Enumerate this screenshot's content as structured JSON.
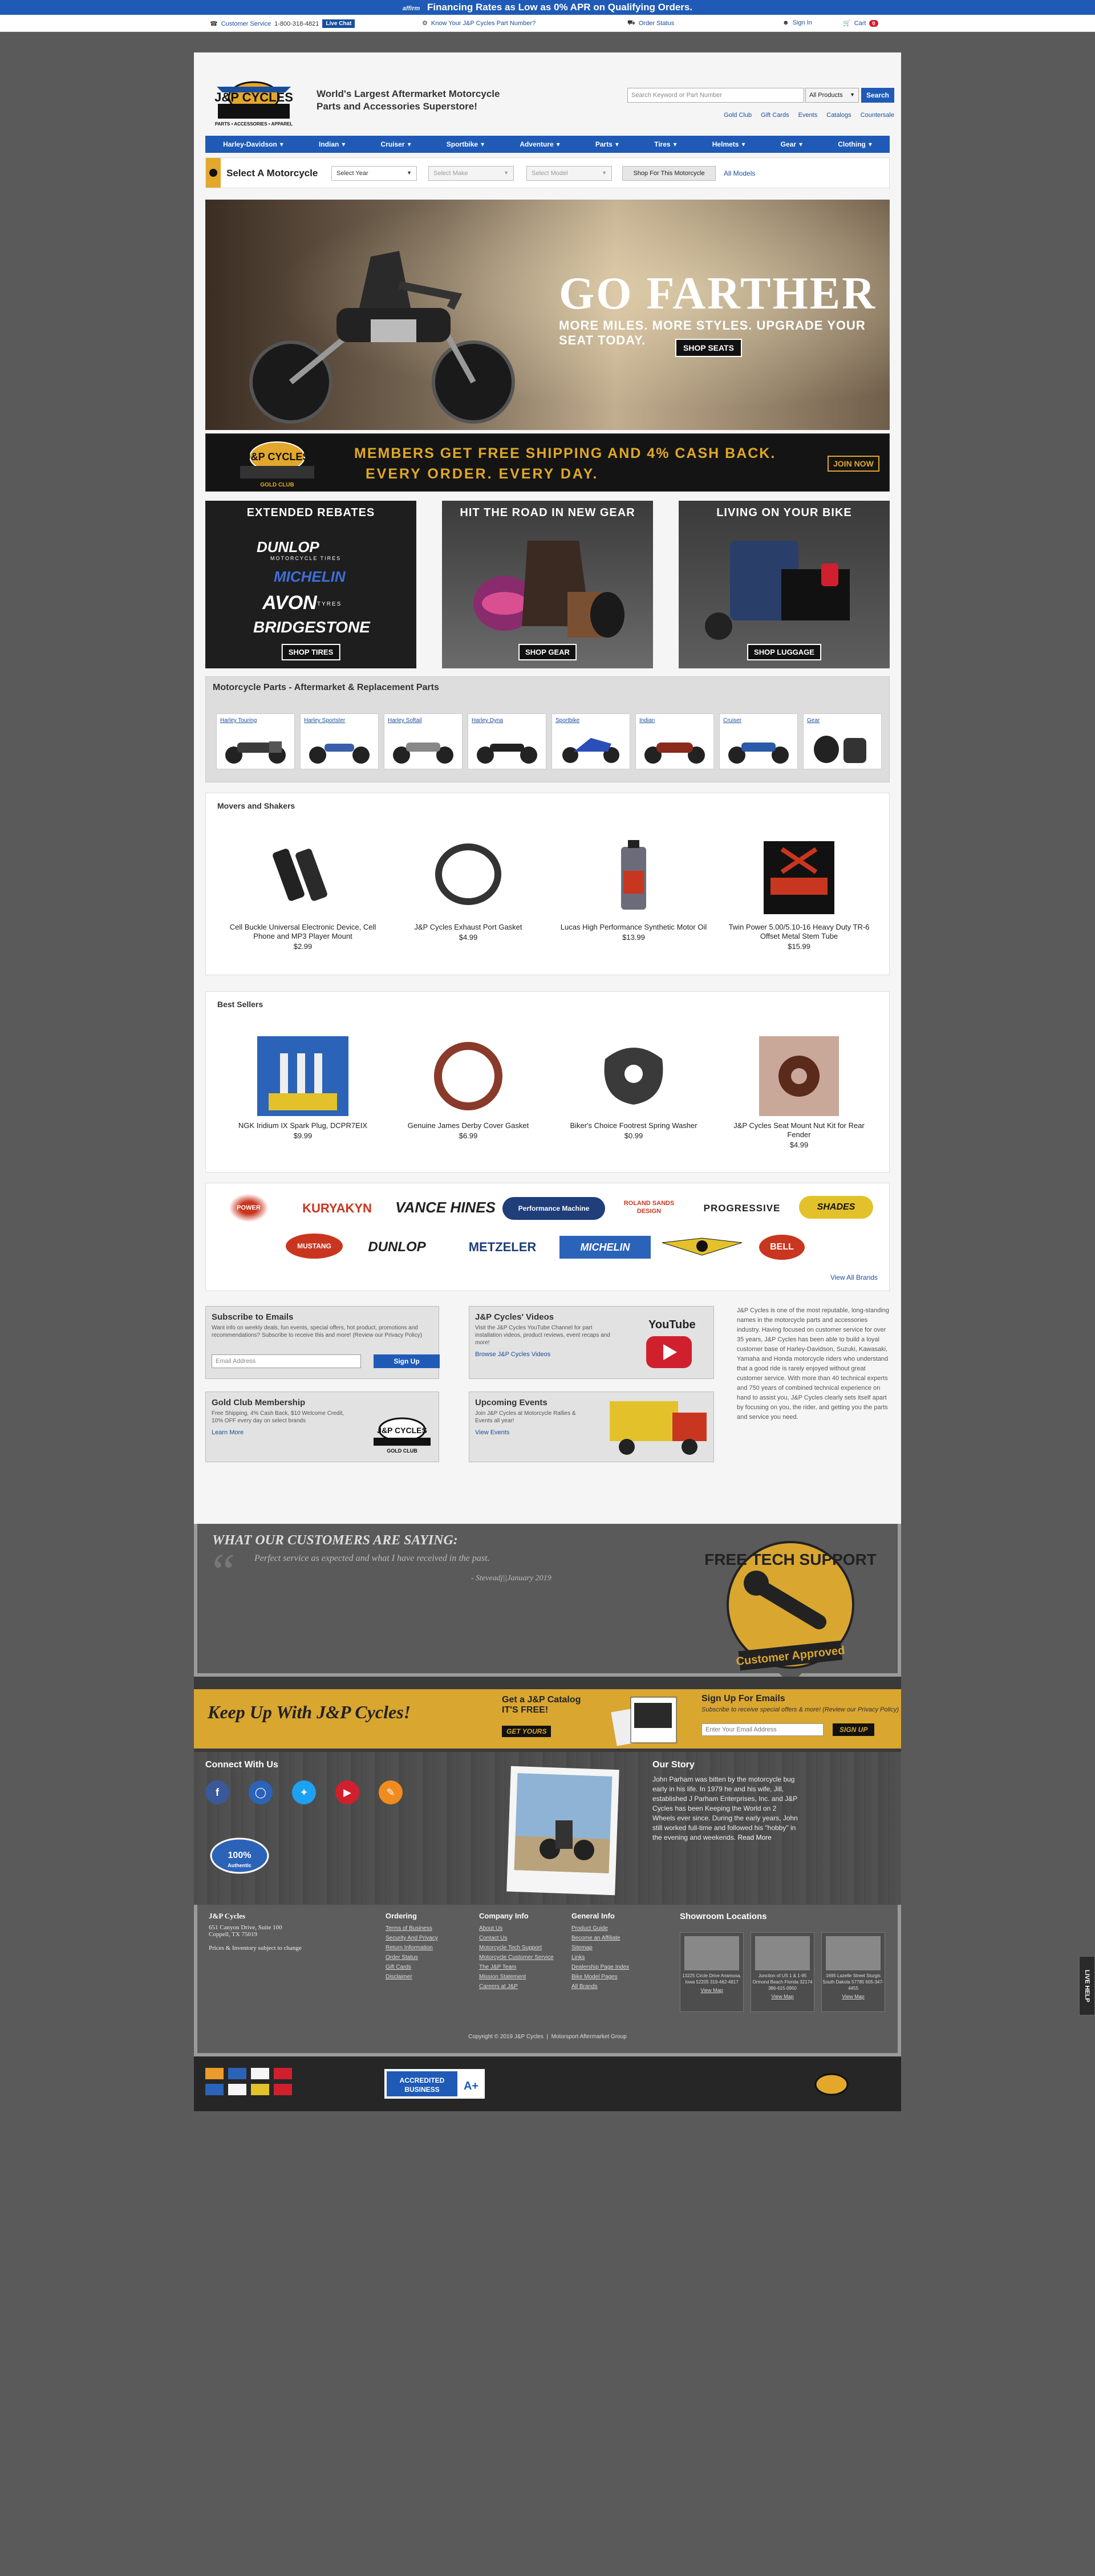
{
  "promo": {
    "brand": "affirm",
    "text": "Financing Rates as Low as 0% APR on Qualifying Orders."
  },
  "util": {
    "customer_service": "Customer Service",
    "phone": "1-800-318-4821",
    "live_chat": "Live Chat",
    "know_part": "Know Your J&P Cycles Part Number?",
    "order_status": "Order Status",
    "sign_in": "Sign In",
    "cart": "Cart",
    "cart_count": "0"
  },
  "header": {
    "logo_text": "J&P CYCLES",
    "logo_sub": "PARTS • ACCESSORIES • APPAREL",
    "tagline": "World's Largest Aftermarket Motorcycle Parts and Accessories Superstore!",
    "search_placeholder": "Search Keyword or Part Number",
    "search_scope": "All Products",
    "search_btn": "Search",
    "links": [
      "Gold Club",
      "Gift Cards",
      "Events",
      "Catalogs",
      "Countersale"
    ]
  },
  "nav": [
    "Harley-Davidson",
    "Indian",
    "Cruiser",
    "Sportbike",
    "Adventure",
    "Parts",
    "Tires",
    "Helmets",
    "Gear",
    "Clothing"
  ],
  "select_moto": {
    "title": "Select A Motorcycle",
    "year": "Select Year",
    "make": "Select Make",
    "model": "Select Model",
    "shop_btn": "Shop For This Motorcycle",
    "all_models": "All Models"
  },
  "hero": {
    "title": "GO FARTHER",
    "sub": "MORE MILES. MORE STYLES. UPGRADE YOUR SEAT TODAY.",
    "btn": "SHOP SEATS"
  },
  "gold": {
    "l1": "MEMBERS GET FREE SHIPPING AND 4% CASH BACK.",
    "l2": "EVERY ORDER. EVERY DAY.",
    "join": "JOIN NOW",
    "logo_sub": "GOLD CLUB"
  },
  "promos": [
    {
      "title": "EXTENDED REBATES",
      "btn": "SHOP TIRES",
      "brands": [
        "DUNLOP",
        "MICHELIN",
        "AVON",
        "BRIDGESTONE"
      ],
      "dunlop_sub": "MOTORCYCLE TIRES",
      "avon_sub": "TYRES"
    },
    {
      "title": "HIT THE ROAD IN NEW GEAR",
      "btn": "SHOP GEAR"
    },
    {
      "title": "LIVING ON YOUR BIKE",
      "btn": "SHOP LUGGAGE"
    }
  ],
  "parts": {
    "title": "Motorcycle Parts - Aftermarket & Replacement Parts",
    "items": [
      "Harley Touring",
      "Harley Sportster",
      "Harley Softail",
      "Harley Dyna",
      "Sportbike",
      "Indian",
      "Cruiser",
      "Gear"
    ]
  },
  "movers": {
    "title": "Movers and Shakers",
    "items": [
      {
        "name": "Cell Buckle Universal Electronic Device, Cell Phone and MP3 Player Mount",
        "price": "$2.99"
      },
      {
        "name": "J&P Cycles Exhaust Port Gasket",
        "price": "$4.99"
      },
      {
        "name": "Lucas High Performance Synthetic Motor Oil",
        "price": "$13.99"
      },
      {
        "name": "Twin Power 5.00/5.10-16 Heavy Duty TR-6 Offset Metal Stem Tube",
        "price": "$15.99"
      }
    ]
  },
  "best": {
    "title": "Best Sellers",
    "items": [
      {
        "name": "NGK Iridium IX Spark Plug, DCPR7EIX",
        "price": "$9.99"
      },
      {
        "name": "Genuine James Derby Cover Gasket",
        "price": "$6.99"
      },
      {
        "name": "Biker's Choice Footrest Spring Washer",
        "price": "$0.99"
      },
      {
        "name": "J&P Cycles Seat Mount Nut Kit for Rear Fender",
        "price": "$4.99"
      }
    ]
  },
  "brands": {
    "row1": [
      "POWER",
      "KURYAKYN",
      "VANCE HINES",
      "Performance Machine",
      "ROLAND SANDS DESIGN",
      "PROGRESSIVE",
      "SHADES"
    ],
    "row2": [
      "MUSTANG",
      "DUNLOP",
      "METZELER",
      "MICHELIN",
      "",
      "BELL"
    ],
    "view_all": "View All Brands"
  },
  "subscribe": {
    "title": "Subscribe to Emails",
    "desc": "Want info on weekly deals, fun events, special offers, hot product, promotions and recommendations? Subscribe to receive this and more! (Review our Privacy Policy)",
    "placeholder": "Email Address",
    "btn": "Sign Up"
  },
  "videos": {
    "title": "J&P Cycles' Videos",
    "desc": "Visit the J&P Cycles YouTube Channel for part installation videos, product reviews, event recaps and more!",
    "link": "Browse J&P Cycles Videos",
    "yt": "YouTube"
  },
  "goldclub": {
    "title": "Gold Club Membership",
    "desc": "Free Shipping, 4% Cash Back, $10 Welcome Credit, 10% OFF every day on select brands",
    "link": "Learn More"
  },
  "events": {
    "title": "Upcoming Events",
    "desc": "Join J&P Cycles at Motorcycle Rallies & Events all year!",
    "link": "View Events"
  },
  "about": "J&P Cycles is one of the most reputable, long-standing names in the motorcycle parts and accessories industry. Having focused on customer service for over 35 years, J&P Cycles has been able to build a loyal customer base of Harley-Davidson, Suzuki, Kawasaki, Yamaha and Honda motorcycle riders who understand that a good ride is rarely enjoyed without great customer service. With more than 40 technical experts and 750 years of combined technical experience on hand to assist you, J&P Cycles clearly sets itself apart by focusing on you, the rider, and getting you the parts and service you need.",
  "testimonials": {
    "heading": "WHAT OUR CUSTOMERS ARE SAYING:",
    "quote": "Perfect service as expected and what I have received in the past.",
    "author": "- Steveadj||January 2019"
  },
  "tech": {
    "l1": "FREE TECH SUPPORT",
    "l2": "Customer Approved"
  },
  "keepup": {
    "heading": "Keep Up With J&P Cycles!",
    "cat": "Get a J&P Catalog",
    "free": "IT'S FREE!",
    "getyours": "GET YOURS",
    "signup_title": "Sign Up For Emails",
    "signup_desc": "Subscribe to receive special offers & more! (Review our Privacy Policy)",
    "email_ph": "Enter Your Email Address",
    "signup_btn": "SIGN UP"
  },
  "connect": {
    "title": "Connect With Us",
    "icons": [
      "facebook-icon",
      "instagram-icon",
      "twitter-icon",
      "youtube-icon",
      "blog-icon"
    ],
    "badge": "100%",
    "badge_sub": "Authentic"
  },
  "story": {
    "title": "Our Story",
    "text": "John Parham was bitten by the motorcycle bug early in his life. In 1979 he and his wife, Jill, established J Parham Enterprises, Inc. and J&P Cycles has been Keeping the World on 2 Wheels ever since. During the early years, John still worked full-time and followed his \"hobby\" in the evening and weekends.",
    "read_more": "Read More"
  },
  "footer": {
    "company": "J&P Cycles",
    "addr1": "651 Canyon Drive, Suite 100",
    "addr2": "Coppell, TX 75019",
    "note": "Prices & Inventory subject to change",
    "ordering": {
      "title": "Ordering",
      "links": [
        "Terms of Business",
        "Security And Privacy",
        "Return Information",
        "Order Status",
        "Gift Cards",
        "Disclaimer"
      ]
    },
    "company_info": {
      "title": "Company Info",
      "links": [
        "About Us",
        "Contact Us",
        "Motorcycle Tech Support",
        "Motorcycle Customer Service",
        "The J&P Team",
        "Mission Statement",
        "Careers at J&P"
      ]
    },
    "general": {
      "title": "General Info",
      "links": [
        "Product Guide",
        "Become an Affiliate",
        "Sitemap",
        "Links",
        "Dealership Page Index",
        "Bike Model Pages",
        "All Brands"
      ]
    },
    "showroom_title": "Showroom Locations",
    "showrooms": [
      {
        "addr": "13225 Circle Drive Anamosa, Iowa 52205 319-462-4817",
        "vm": "View Map"
      },
      {
        "addr": "Junction of US 1 & 1-95 Ormond Beach Florida 32174 386-615-0950",
        "vm": "View Map"
      },
      {
        "addr": "1695 Lazelle Street Sturgis South Dakota 57785 605-347-4455",
        "vm": "View Map"
      }
    ],
    "copyright": "Copyright © 2019 J&P Cycles",
    "mag": "Motorsport Aftermarket Group"
  },
  "bbb": {
    "l1": "ACCREDITED",
    "l2": "BUSINESS",
    "rating": "A+"
  },
  "live_help": "LIVE HELP"
}
